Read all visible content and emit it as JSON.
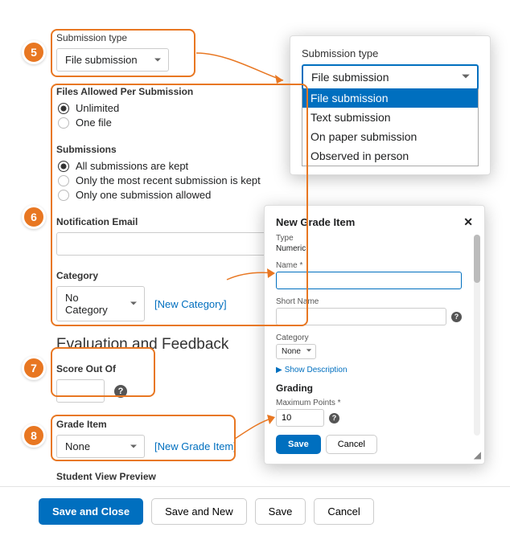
{
  "steps": {
    "s5": "5",
    "s6": "6",
    "s7": "7",
    "s8": "8"
  },
  "submissionType": {
    "label": "Submission type",
    "value": "File submission"
  },
  "filesAllowed": {
    "label": "Files Allowed Per Submission",
    "opts": [
      "Unlimited",
      "One file"
    ],
    "selected": 0
  },
  "submissions": {
    "label": "Submissions",
    "opts": [
      "All submissions are kept",
      "Only the most recent submission is kept",
      "Only one submission allowed"
    ],
    "selected": 0
  },
  "notificationEmail": {
    "label": "Notification Email",
    "value": ""
  },
  "category": {
    "label": "Category",
    "value": "No Category",
    "newLink": "[New Category]"
  },
  "evalHeading": "Evaluation and Feedback",
  "score": {
    "label": "Score Out Of",
    "value": ""
  },
  "gradeItem": {
    "label": "Grade Item",
    "value": "None",
    "newLink": "[New Grade Item]"
  },
  "studentView": {
    "label": "Student View Preview"
  },
  "typePopout": {
    "label": "Submission type",
    "value": "File submission",
    "options": [
      "File submission",
      "Text submission",
      "On paper submission",
      "Observed in person"
    ],
    "selected": 0
  },
  "gradeModal": {
    "title": "New Grade Item",
    "typeLabel": "Type",
    "typeValue": "Numeric",
    "nameLabel": "Name *",
    "nameValue": "",
    "shortLabel": "Short Name",
    "shortValue": "",
    "catLabel": "Category",
    "catValue": "None",
    "showDesc": "Show Description",
    "gradingHead": "Grading",
    "maxLabel": "Maximum Points *",
    "maxValue": "10",
    "save": "Save",
    "cancel": "Cancel"
  },
  "footer": {
    "saveClose": "Save and Close",
    "saveNew": "Save and New",
    "save": "Save",
    "cancel": "Cancel"
  }
}
